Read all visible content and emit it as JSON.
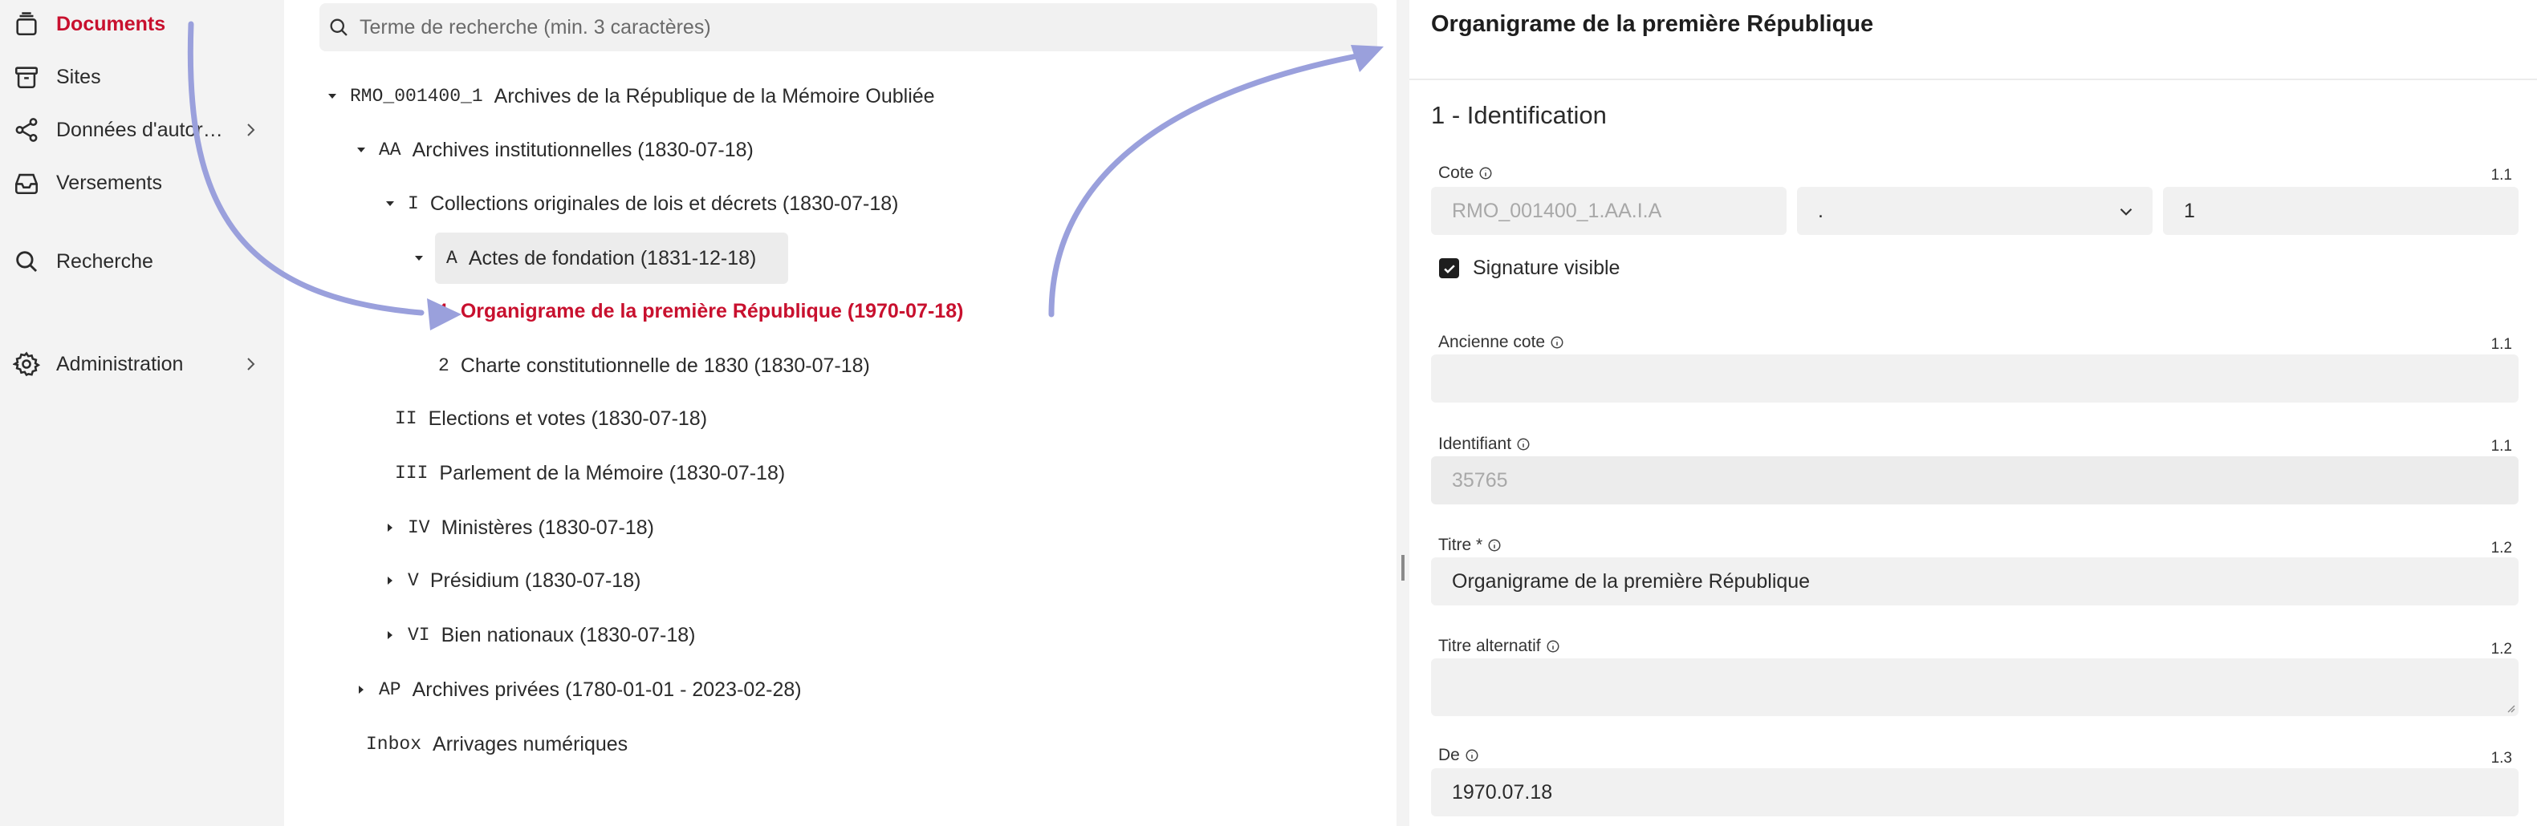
{
  "sidebar": {
    "items": [
      {
        "label": "Documents",
        "icon": "documents-stack-icon",
        "active": true
      },
      {
        "label": "Sites",
        "icon": "archive-box-icon"
      },
      {
        "label": "Données d'autorité",
        "icon": "share-nodes-icon",
        "has_submenu": true
      },
      {
        "label": "Versements",
        "icon": "inbox-tray-icon"
      },
      {
        "label": "Recherche",
        "icon": "search-icon"
      },
      {
        "label": "Administration",
        "icon": "gear-icon",
        "has_submenu": true
      }
    ]
  },
  "tree": {
    "search_placeholder": "Terme de recherche (min. 3 caractères)",
    "nodes": [
      {
        "code": "RMO_001400_1",
        "label": "Archives de la République de la Mémoire Oubliée",
        "toggle": "expanded"
      },
      {
        "code": "AA",
        "label": "Archives institutionnelles (1830-07-18)",
        "toggle": "expanded"
      },
      {
        "code": "I",
        "label": "Collections originales de lois et décrets (1830-07-18)",
        "toggle": "expanded"
      },
      {
        "code": "A",
        "label": "Actes de fondation (1831-12-18)",
        "toggle": "expanded"
      },
      {
        "code": "1",
        "label": "Organigrame de la première République (1970-07-18)",
        "toggle": "none",
        "current": true
      },
      {
        "code": "2",
        "label": "Charte constitutionnelle de 1830 (1830-07-18)",
        "toggle": "none"
      },
      {
        "code": "II",
        "label": "Elections et votes (1830-07-18)",
        "toggle": "none"
      },
      {
        "code": "III",
        "label": "Parlement de la Mémoire (1830-07-18)",
        "toggle": "none"
      },
      {
        "code": "IV",
        "label": "Ministères (1830-07-18)",
        "toggle": "collapsed"
      },
      {
        "code": "V",
        "label": "Présidium (1830-07-18)",
        "toggle": "collapsed"
      },
      {
        "code": "VI",
        "label": "Bien nationaux (1830-07-18)",
        "toggle": "collapsed"
      },
      {
        "code": "AP",
        "label": "Archives privées (1780-01-01 - 2023-02-28)",
        "toggle": "collapsed"
      },
      {
        "code": "Inbox",
        "label": "Arrivages numériques",
        "toggle": "none"
      }
    ]
  },
  "detail": {
    "title": "Organigrame de la première République",
    "section": "1 - Identification",
    "cote": {
      "label": "Cote",
      "num": "1.1",
      "prefix": "RMO_001400_1.AA.I.A",
      "separator": ".",
      "value": "1"
    },
    "signature": {
      "label": "Signature visible",
      "checked": true
    },
    "ancienne_cote": {
      "label": "Ancienne cote",
      "num": "1.1",
      "value": ""
    },
    "identifiant": {
      "label": "Identifiant",
      "num": "1.1",
      "value": "35765"
    },
    "titre": {
      "label": "Titre *",
      "num": "1.2",
      "value": "Organigrame de la première République"
    },
    "titre_alternatif": {
      "label": "Titre alternatif",
      "num": "1.2",
      "value": ""
    },
    "de": {
      "label": "De",
      "num": "1.3",
      "value": "1970.07.18"
    }
  },
  "colors": {
    "accent": "#c8102e",
    "sidebar_bg": "#f3f3f3",
    "field_bg": "#f1f1f1",
    "annotation_arrow": "#9aa0dc"
  }
}
